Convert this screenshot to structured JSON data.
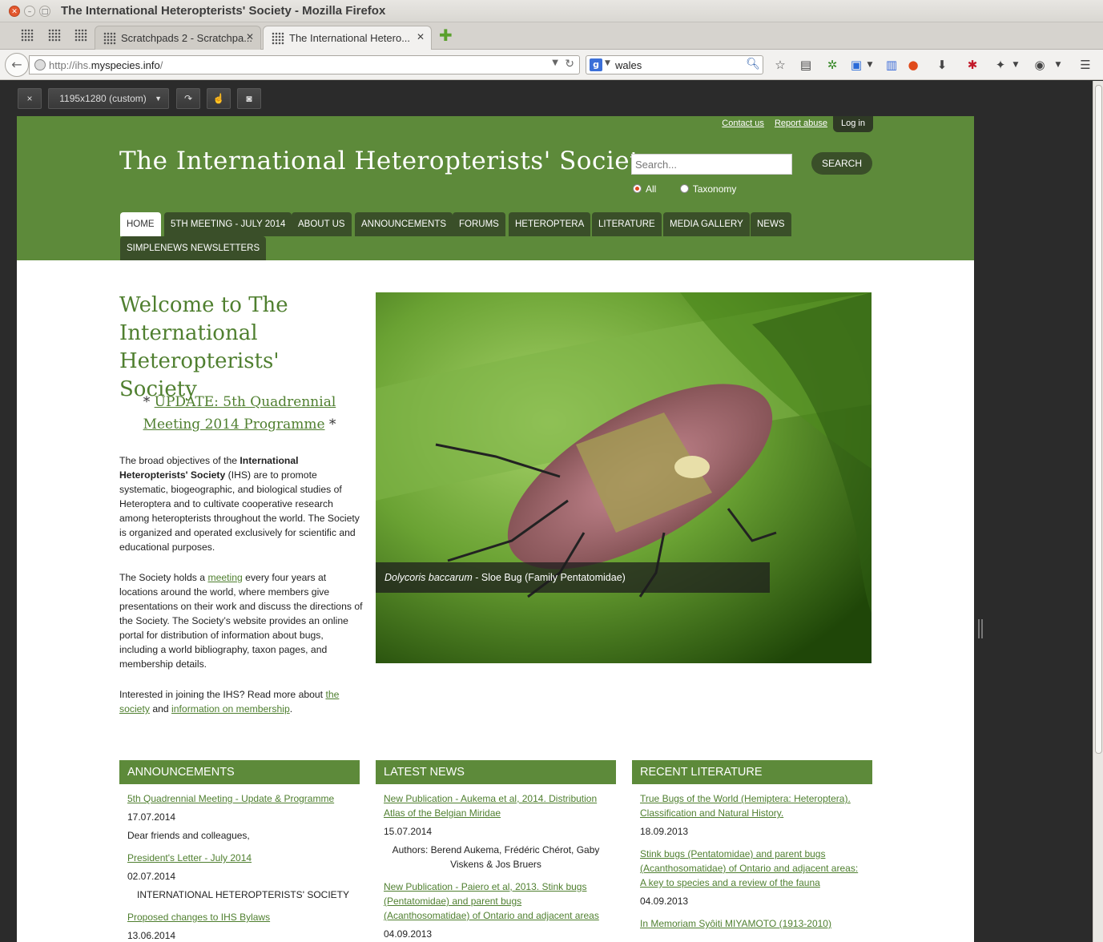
{
  "window": {
    "title": "The International Heteropterists' Society - Mozilla Firefox"
  },
  "tabs": [
    {
      "label": "Scratchpads 2 - Scratchpa..."
    },
    {
      "label": "The International Hetero..."
    }
  ],
  "navbar": {
    "url_prefix": "http://ihs.",
    "url_domain": "myspecies.info",
    "url_suffix": "/",
    "search_query": "wales"
  },
  "rdm": {
    "close": "×",
    "size_select": "1195x1280 (custom)"
  },
  "site": {
    "toplinks": [
      "Contact us",
      "Report abuse"
    ],
    "login": "Log in",
    "title": "The International Heteropterists' Society",
    "search_placeholder": "Search...",
    "search_button": "SEARCH",
    "radio_all": "All",
    "radio_taxonomy": "Taxonomy",
    "menu": [
      "HOME",
      "5TH MEETING - JULY 2014",
      "ABOUT US",
      "ANNOUNCEMENTS",
      "FORUMS",
      "HETEROPTERA",
      "LITERATURE",
      "MEDIA GALLERY",
      "NEWS",
      "SIMPLENEWS NEWSLETTERS"
    ]
  },
  "main": {
    "welcome": "Welcome to The International Heteropterists' Society",
    "update_prefix": "* ",
    "update_link": "UPDATE: 5th Quadrennial Meeting 2014 Programme",
    "update_suffix": " *",
    "p1_a": "The broad objectives of the ",
    "p1_bold": "International Heteropterists' Society",
    "p1_b": " (IHS) are to promote systematic, biogeographic, and biological studies of Heteroptera and to cultivate cooperative research among heteropterists throughout the world. The Society is organized and operated exclusively for scientific and educational purposes.",
    "p2_a": "The Society holds a ",
    "p2_link": "meeting",
    "p2_b": " every four years at locations around the world, where members give presentations on their work and discuss the directions of the Society. The Society’s website provides an online portal for distribution of information about bugs, including a world bibliography, taxon pages, and membership details.",
    "p3_a": "Interested in joining the IHS? Read more about ",
    "p3_link1": "the society",
    "p3_b": " and ",
    "p3_link2": "information on membership",
    "p3_c": ".",
    "caption_italic": "Dolycoris baccarum",
    "caption_rest": " - Sloe Bug (Family Pentatomidae)"
  },
  "panels": {
    "announcements": {
      "title": "ANNOUNCEMENTS",
      "items": [
        {
          "title": "5th Quadrennial Meeting - Update & Programme",
          "date": "17.07.2014",
          "excerpt": "Dear friends and colleagues,"
        },
        {
          "title": "President's Letter - July 2014",
          "date": "02.07.2014",
          "excerpt": "INTERNATIONAL HETEROPTERISTS' SOCIETY"
        },
        {
          "title": "Proposed changes to IHS Bylaws",
          "date": "13.06.2014"
        }
      ]
    },
    "news": {
      "title": "LATEST NEWS",
      "items": [
        {
          "title": "New Publication - Aukema et al, 2014. Distribution Atlas of the Belgian Miridae",
          "date": "15.07.2014",
          "excerpt": "Authors: Berend Aukema, Frédéric Chérot, Gaby Viskens & Jos Bruers"
        },
        {
          "title": "New Publication - Paiero et al, 2013. Stink bugs (Pentatomidae) and parent bugs (Acanthosomatidae) of Ontario and adjacent areas",
          "date": "04.09.2013"
        }
      ]
    },
    "literature": {
      "title": "RECENT LITERATURE",
      "items": [
        {
          "title": "True Bugs of the World (Hemiptera: Heteroptera). Classification and Natural History.",
          "date": "18.09.2013"
        },
        {
          "title": "Stink bugs (Pentatomidae) and parent bugs (Acanthosomatidae) of Ontario and adjacent areas: A key to species and a review of the fauna",
          "date": "04.09.2013"
        },
        {
          "title": "In Memoriam Syôiti MIYAMOTO (1913-2010)"
        }
      ]
    }
  },
  "colors": {
    "brand_green": "#5d8a3a",
    "dark_green": "#3a4f29",
    "link_green": "#4f7f2f"
  }
}
